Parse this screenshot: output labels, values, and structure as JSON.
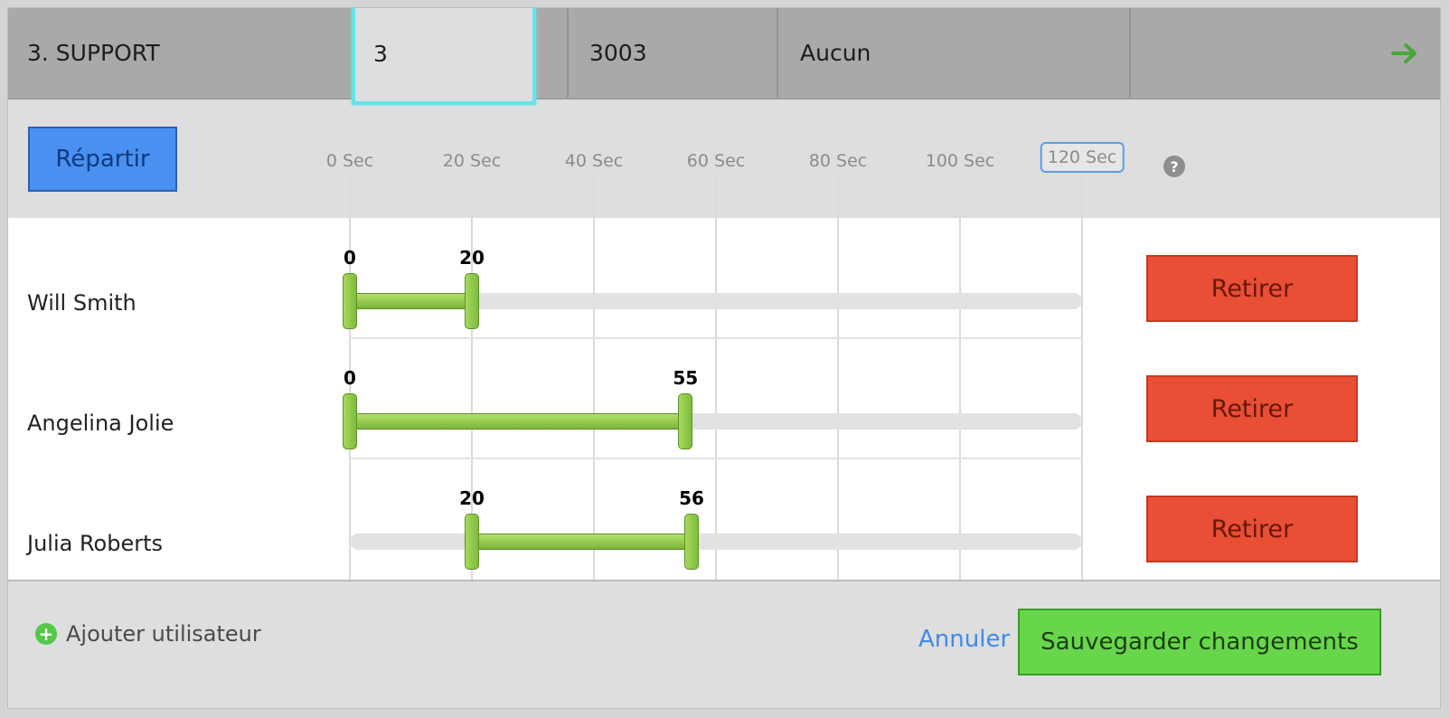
{
  "header": {
    "queue": "3. SUPPORT",
    "position": "3",
    "extension": "3003",
    "overflow": "Aucun",
    "next_icon": "arrow-right-icon"
  },
  "toolbar": {
    "distribute_label": "Répartir",
    "help_icon": "?"
  },
  "timeline": {
    "ticks": [
      "0 Sec",
      "20 Sec",
      "40 Sec",
      "60 Sec",
      "80 Sec",
      "100 Sec",
      "120 Sec"
    ],
    "max_seconds": 120
  },
  "users": [
    {
      "name": "Will Smith",
      "start": 0,
      "end": 20,
      "start_label": "0",
      "end_label": "20",
      "remove_label": "Retirer"
    },
    {
      "name": "Angelina Jolie",
      "start": 0,
      "end": 55,
      "start_label": "0",
      "end_label": "55",
      "remove_label": "Retirer"
    },
    {
      "name": "Julia Roberts",
      "start": 20,
      "end": 56,
      "start_label": "20",
      "end_label": "56",
      "remove_label": "Retirer"
    }
  ],
  "footer": {
    "add_user_label": "Ajouter utilisateur",
    "cancel_label": "Annuler",
    "save_label": "Sauvegarder changements"
  },
  "colors": {
    "accent_blue": "#4a90f0",
    "remove_red": "#e84f34",
    "save_green": "#67d64b",
    "selection_cyan": "#62e6ea"
  }
}
